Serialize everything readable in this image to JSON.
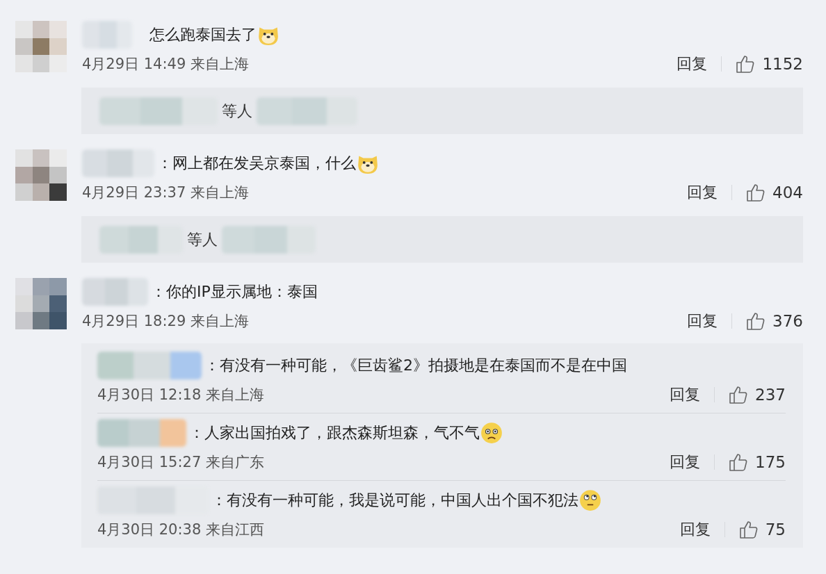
{
  "comments": [
    {
      "text": "怎么跑泰国去了",
      "emoji": {
        "kind": "dog"
      },
      "meta": "4月29日 14:49 来自上海",
      "reply_label": "回复",
      "likes": "1152",
      "liked_by": {
        "suffix": "等人"
      }
    },
    {
      "text": "：网上都在发吴京泰国，什么",
      "emoji": {
        "kind": "dog"
      },
      "meta": "4月29日 23:37 来自上海",
      "reply_label": "回复",
      "likes": "404",
      "liked_by": {
        "suffix": "等人"
      }
    },
    {
      "text": "：你的IP显示属地：泰国",
      "meta": "4月29日 18:29 来自上海",
      "reply_label": "回复",
      "likes": "376",
      "replies": [
        {
          "text": "：有没有一种可能，《巨齿鲨2》拍摄地是在泰国而不是在中国",
          "meta": "4月30日 12:18 来自上海",
          "reply_label": "回复",
          "likes": "237"
        },
        {
          "text": "：人家出国拍戏了，跟杰森斯坦森，气不气",
          "emoji": {
            "kind": "sad"
          },
          "meta": "4月30日 15:27 来自广东",
          "reply_label": "回复",
          "likes": "175"
        },
        {
          "text": "：有没有一种可能，我是说可能，中国人出个国不犯法",
          "emoji": {
            "kind": "eyeroll"
          },
          "meta": "4月30日 20:38 来自江西",
          "reply_label": "回复",
          "likes": "75"
        }
      ]
    }
  ]
}
